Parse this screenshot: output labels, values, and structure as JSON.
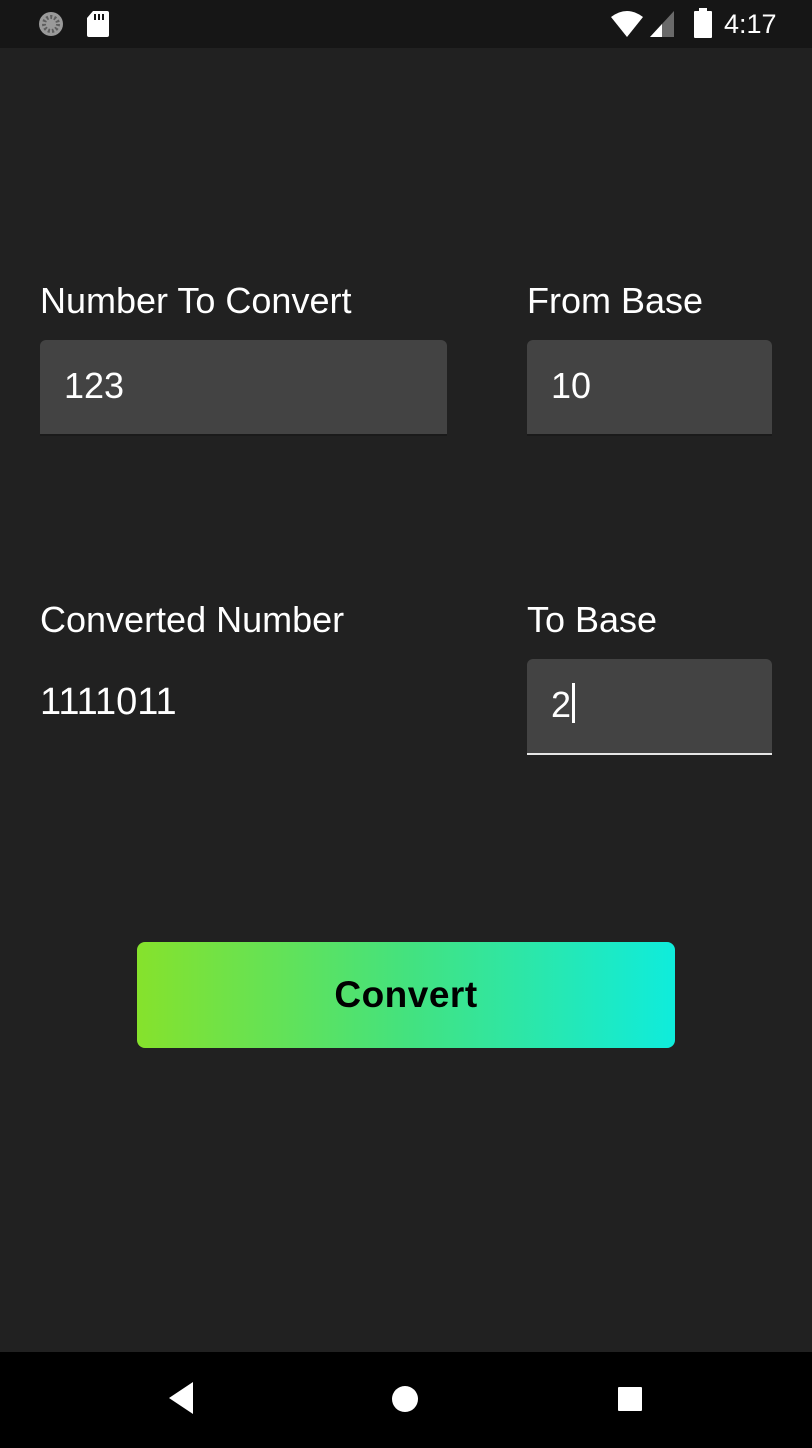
{
  "status_bar": {
    "time": "4:17",
    "icons": [
      "loading-icon",
      "sd-card-icon",
      "wifi-icon",
      "cell-signal-icon",
      "battery-icon"
    ]
  },
  "form": {
    "number_label": "Number To Convert",
    "number_value": "123",
    "from_base_label": "From Base",
    "from_base_value": "10",
    "converted_label": "Converted Number",
    "converted_value": "1111011",
    "to_base_label": "To Base",
    "to_base_value": "2"
  },
  "button": {
    "convert_label": "Convert"
  },
  "nav_bar": {
    "icons": [
      "back-icon",
      "home-icon",
      "recents-icon"
    ]
  },
  "colors": {
    "background": "#212121",
    "field": "#434343",
    "button_gradient_start": "#86e22c",
    "button_gradient_end": "#0fecdc"
  }
}
